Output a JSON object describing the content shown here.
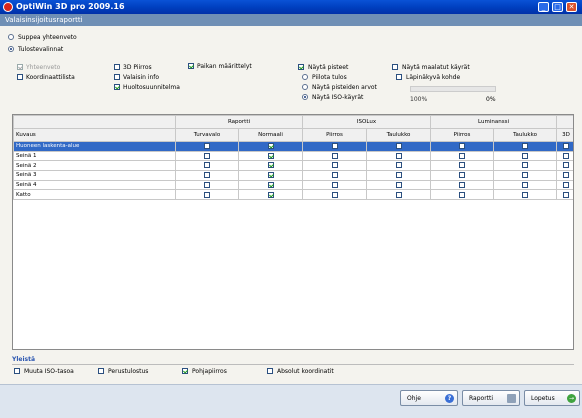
{
  "window": {
    "title": "OptiWin 3D pro 2009.16",
    "min": "_",
    "max": "□",
    "close": "✕"
  },
  "dialog": {
    "title": "Valaisinsijoitusraportti"
  },
  "mode": {
    "summary": "Suppea yhteenveto",
    "print_options": "Tulostevalinnat"
  },
  "options": {
    "col1": [
      {
        "label": "Yhteenveto",
        "checked": true,
        "disabled": true
      },
      {
        "label": "Koordinaattilista",
        "checked": false
      }
    ],
    "col2": [
      {
        "label": "3D Piirros",
        "checked": false
      },
      {
        "label": "Valaisin info",
        "checked": false
      },
      {
        "label": "Huoltosuunnitelma",
        "checked": true
      }
    ],
    "col3": [
      {
        "label": "Paikan määrittelyt",
        "checked": true
      }
    ],
    "col4": [
      {
        "label": "Näytä pisteet",
        "checked": true
      }
    ],
    "col5": [
      {
        "label": "Näytä maalatut käyrät",
        "checked": false
      },
      {
        "label": "Läpinäkyvä kohde",
        "checked": false
      }
    ],
    "radios": [
      {
        "label": "Piilota tulos",
        "selected": false
      },
      {
        "label": "Näytä pisteiden arvot",
        "selected": false
      },
      {
        "label": "Näytä ISO-käyrät",
        "selected": true
      }
    ],
    "slider": {
      "left_label": "100%",
      "right_label": "0%"
    }
  },
  "table": {
    "group_headers": {
      "raportti": "Raportti",
      "isolux": "ISOLux",
      "luminanssi": "Luminanssi"
    },
    "columns": [
      "Kuvaus",
      "Turvavalo",
      "Normaali",
      "Piirros",
      "Taulukko",
      "Piirros",
      "Taulukko",
      "3D"
    ],
    "rows": [
      {
        "name": "Huoneen laskenta-alue",
        "checks": [
          false,
          true,
          false,
          false,
          false,
          false,
          false
        ],
        "selected": true
      },
      {
        "name": "Seinä 1",
        "checks": [
          false,
          true,
          false,
          false,
          false,
          false,
          false
        ],
        "selected": false
      },
      {
        "name": "Seinä 2",
        "checks": [
          false,
          true,
          false,
          false,
          false,
          false,
          false
        ],
        "selected": false
      },
      {
        "name": "Seinä 3",
        "checks": [
          false,
          true,
          false,
          false,
          false,
          false,
          false
        ],
        "selected": false
      },
      {
        "name": "Seinä 4",
        "checks": [
          false,
          true,
          false,
          false,
          false,
          false,
          false
        ],
        "selected": false
      },
      {
        "name": "Katto",
        "checks": [
          false,
          true,
          false,
          false,
          false,
          false,
          false
        ],
        "selected": false
      }
    ]
  },
  "general": {
    "title": "Yleistä",
    "items": [
      {
        "label": "Muuta ISO-tasoa",
        "checked": false
      },
      {
        "label": "Perustulostus",
        "checked": false
      },
      {
        "label": "Pohjapiirros",
        "checked": true
      },
      {
        "label": "Absolut koordinatit",
        "checked": false
      }
    ]
  },
  "buttons": {
    "help": "Ohje",
    "report": "Raportti",
    "exit": "Lopetus",
    "help_icon": "?",
    "exit_icon": "→"
  },
  "colors": {
    "titlebar": "#0040c0",
    "selection": "#3169c6",
    "section_title": "#2a55b0"
  }
}
